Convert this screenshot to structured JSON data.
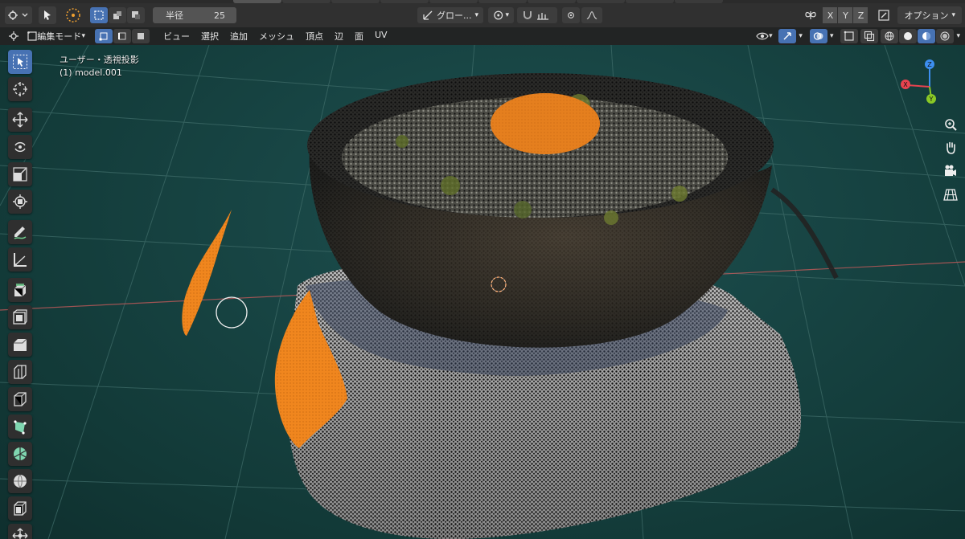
{
  "header": {
    "radius_label": "半径",
    "radius_value": "25",
    "transform_orientation": "グロー...",
    "axes": [
      "X",
      "Y",
      "Z"
    ],
    "options_label": "オプション"
  },
  "editbar": {
    "mode": "編集モード",
    "menus": [
      "ビュー",
      "選択",
      "追加",
      "メッシュ",
      "頂点",
      "辺",
      "面",
      "UV"
    ]
  },
  "viewport": {
    "view_name": "ユーザー・透視投影",
    "object_name": "(1) model.001"
  },
  "gizmo": {
    "x_color": "#e8434f",
    "y_color": "#8ac926",
    "z_color": "#3d8ff0"
  },
  "toolbar": {
    "tools": [
      "select-box",
      "cursor",
      "move",
      "rotate",
      "scale",
      "transform",
      "annotate",
      "measure",
      "extrude-region",
      "inset-faces",
      "bevel",
      "loop-cut",
      "knife",
      "poly-build",
      "spin",
      "smooth",
      "edge-slide",
      "shrink-fatten",
      "shear"
    ]
  },
  "colors": {
    "accent": "#4772b3",
    "selection": "#f0861e",
    "viewport_bg": "#174443"
  }
}
